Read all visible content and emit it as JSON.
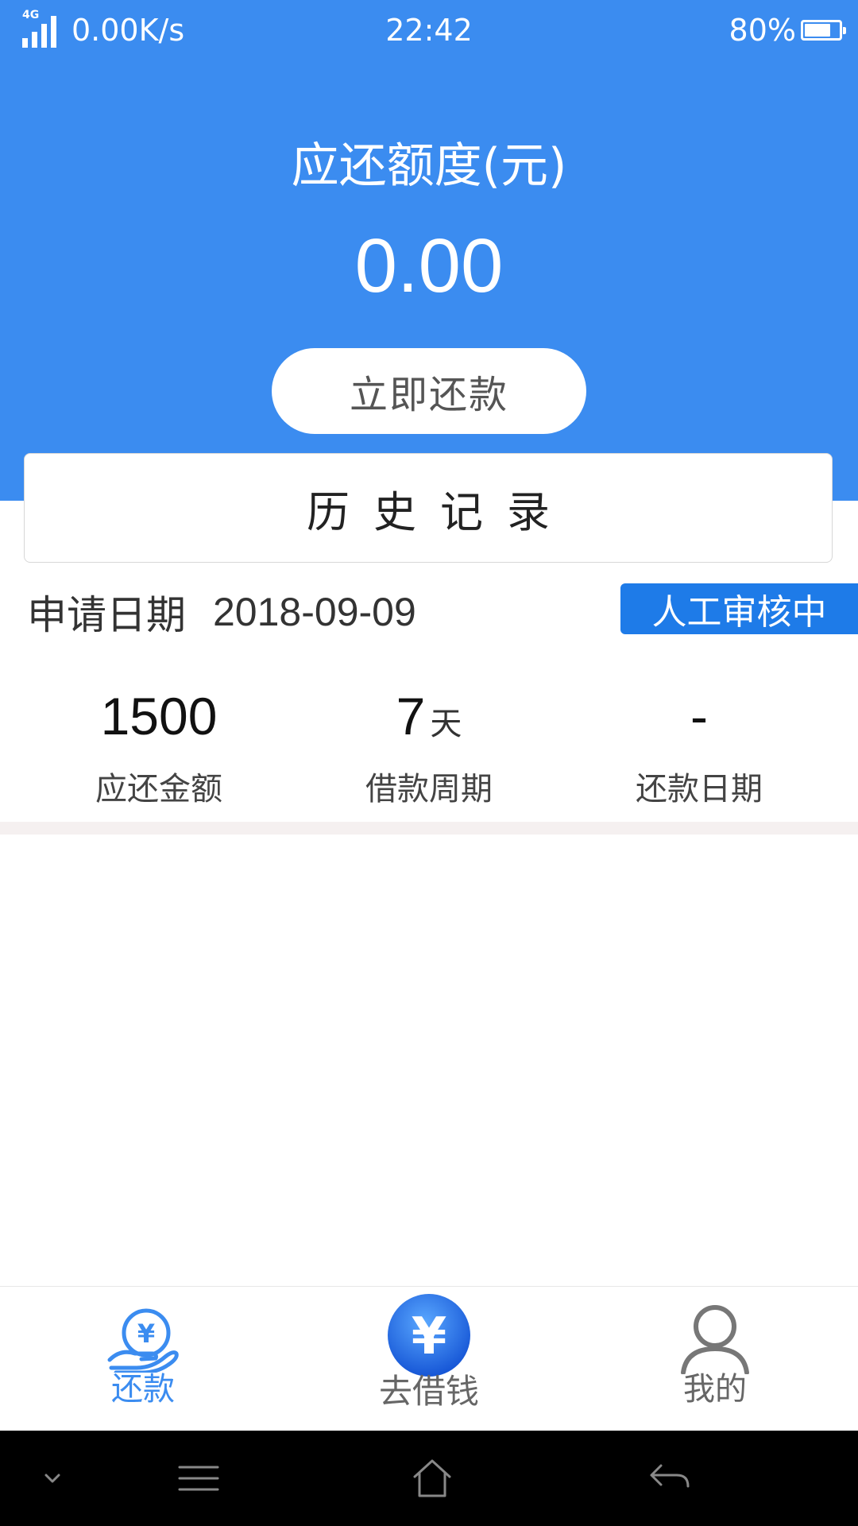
{
  "status_bar": {
    "network_tag": "4G",
    "speed": "0.00K/s",
    "time": "22:42",
    "battery_percent": "80%",
    "battery_level": 0.8
  },
  "header": {
    "title": "应还额度(元)",
    "amount": "0.00",
    "repay_button_label": "立即还款"
  },
  "history": {
    "title": "历史记录"
  },
  "record": {
    "apply_label": "申请日期",
    "apply_date": "2018-09-09",
    "status": "人工审核中",
    "stats": [
      {
        "value": "1500",
        "unit": "",
        "label": "应还金额"
      },
      {
        "value": "7",
        "unit": "天",
        "label": "借款周期"
      },
      {
        "value": "-",
        "unit": "",
        "label": "还款日期"
      }
    ]
  },
  "tabbar": {
    "items": [
      {
        "label": "还款",
        "icon": "hand-yen-icon",
        "active": true
      },
      {
        "label": "去借钱",
        "icon": "yen-coin-icon",
        "active": false
      },
      {
        "label": "我的",
        "icon": "user-icon",
        "active": false
      }
    ]
  },
  "navbar": {
    "icons": [
      "chevron-down-icon",
      "menu-icon",
      "home-icon",
      "back-icon"
    ]
  },
  "colors": {
    "primary": "#3b8cf0",
    "badge": "#1e7be8"
  }
}
